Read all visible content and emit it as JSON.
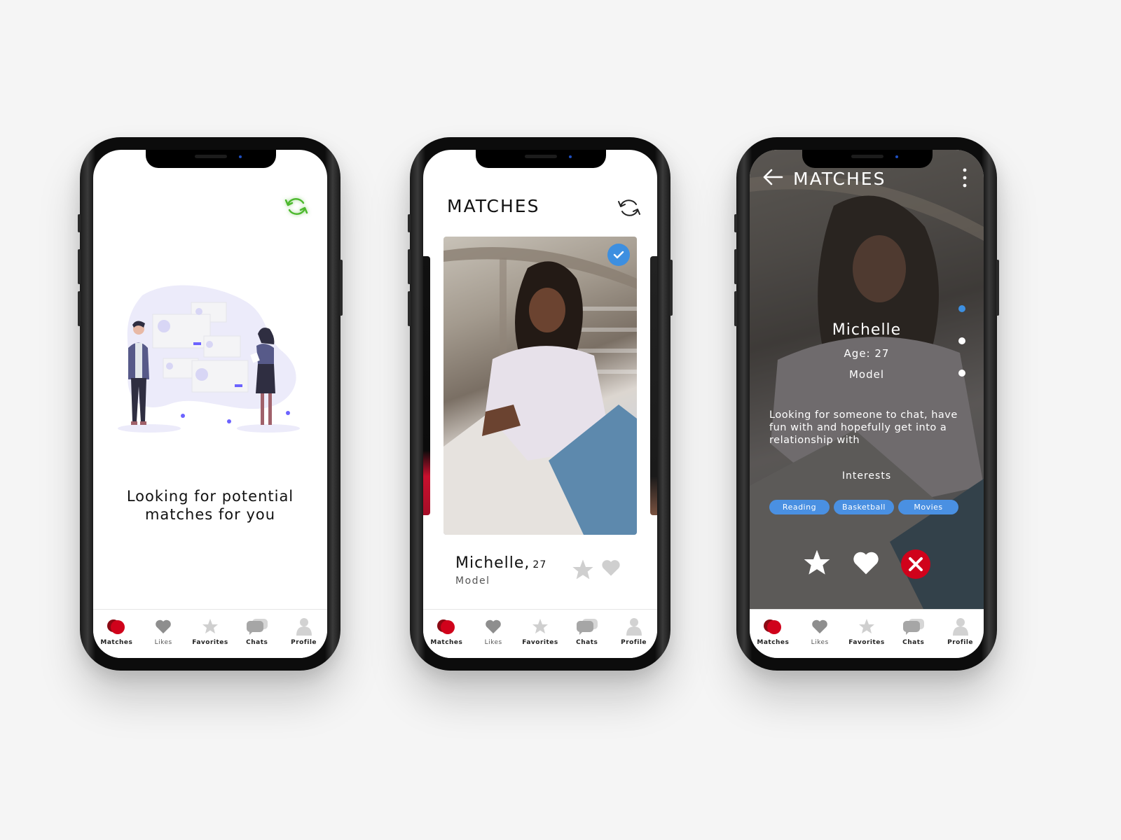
{
  "tabbar": {
    "items": [
      {
        "label": "Matches",
        "icon": "matches-icon"
      },
      {
        "label": "Likes",
        "icon": "heart-icon"
      },
      {
        "label": "Favorites",
        "icon": "star-icon"
      },
      {
        "label": "Chats",
        "icon": "chat-bubbles-icon"
      },
      {
        "label": "Profile",
        "icon": "person-icon"
      }
    ]
  },
  "colors": {
    "accent_red": "#d0021b",
    "accent_blue": "#4a90e2",
    "sync_green": "#4cb82d"
  },
  "screen1": {
    "status_message": "Looking for potential matches for you",
    "refresh_icon": "sync-icon"
  },
  "screen2": {
    "title": "MATCHES",
    "refresh_icon": "sync-icon",
    "card": {
      "name": "Michelle,",
      "age": "27",
      "occupation": "Model",
      "verified_icon": "checkmark-icon"
    }
  },
  "screen3": {
    "title": "MATCHES",
    "back_icon": "arrow-left-icon",
    "more_icon": "more-vertical-icon",
    "profile": {
      "name": "Michelle",
      "age": "Age: 27",
      "occupation": "Model",
      "bio": "Looking for someone to chat, have fun with and hopefully get into a relationship with",
      "interests_label": "Interests",
      "interests": [
        "Reading",
        "Basketball",
        "Movies"
      ]
    },
    "photo_pager": {
      "count": 3,
      "active_index": 0
    }
  }
}
